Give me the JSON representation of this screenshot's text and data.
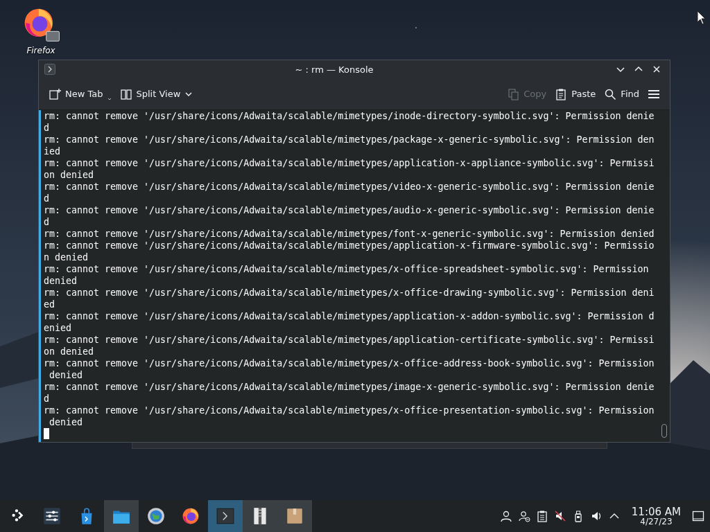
{
  "desktop": {
    "icons": [
      {
        "label": "Firefox"
      }
    ]
  },
  "window": {
    "title": "~ : rm — Konsole",
    "toolbar": [
      {
        "kind": "newtab",
        "label": "New Tab",
        "disabled": false
      },
      {
        "kind": "split",
        "label": "Split View",
        "disabled": false
      },
      {
        "kind": "copy",
        "label": "Copy",
        "disabled": true
      },
      {
        "kind": "paste",
        "label": "Paste",
        "disabled": false
      },
      {
        "kind": "find",
        "label": "Find",
        "disabled": false
      },
      {
        "kind": "menu",
        "disabled": false
      }
    ],
    "terminal": {
      "lines": [
        "rm: cannot remove '/usr/share/icons/Adwaita/scalable/mimetypes/inode-directory-symbolic.svg': Permission denied",
        "rm: cannot remove '/usr/share/icons/Adwaita/scalable/mimetypes/package-x-generic-symbolic.svg': Permission denied",
        "rm: cannot remove '/usr/share/icons/Adwaita/scalable/mimetypes/application-x-appliance-symbolic.svg': Permission denied",
        "rm: cannot remove '/usr/share/icons/Adwaita/scalable/mimetypes/video-x-generic-symbolic.svg': Permission denied",
        "rm: cannot remove '/usr/share/icons/Adwaita/scalable/mimetypes/audio-x-generic-symbolic.svg': Permission denied",
        "rm: cannot remove '/usr/share/icons/Adwaita/scalable/mimetypes/font-x-generic-symbolic.svg': Permission denied",
        "rm: cannot remove '/usr/share/icons/Adwaita/scalable/mimetypes/application-x-firmware-symbolic.svg': Permission denied",
        "rm: cannot remove '/usr/share/icons/Adwaita/scalable/mimetypes/x-office-spreadsheet-symbolic.svg': Permission denied",
        "rm: cannot remove '/usr/share/icons/Adwaita/scalable/mimetypes/x-office-drawing-symbolic.svg': Permission denied",
        "rm: cannot remove '/usr/share/icons/Adwaita/scalable/mimetypes/application-x-addon-symbolic.svg': Permission denied",
        "rm: cannot remove '/usr/share/icons/Adwaita/scalable/mimetypes/application-certificate-symbolic.svg': Permission denied",
        "rm: cannot remove '/usr/share/icons/Adwaita/scalable/mimetypes/x-office-address-book-symbolic.svg': Permission denied",
        "rm: cannot remove '/usr/share/icons/Adwaita/scalable/mimetypes/image-x-generic-symbolic.svg': Permission denied",
        "rm: cannot remove '/usr/share/icons/Adwaita/scalable/mimetypes/x-office-presentation-symbolic.svg': Permission denied"
      ]
    }
  },
  "taskbar": {
    "tasks": [
      {
        "kind": "launcher",
        "open": false,
        "selected": false
      },
      {
        "kind": "settings-panel",
        "open": false,
        "selected": false
      },
      {
        "kind": "store",
        "open": false,
        "selected": false
      },
      {
        "kind": "files",
        "open": true,
        "selected": false
      },
      {
        "kind": "system-settings",
        "open": false,
        "selected": false
      },
      {
        "kind": "firefox",
        "open": false,
        "selected": false
      },
      {
        "kind": "terminal",
        "open": true,
        "selected": true
      },
      {
        "kind": "archive",
        "open": true,
        "selected": false
      },
      {
        "kind": "package",
        "open": true,
        "selected": false
      }
    ],
    "clock": {
      "time": "11:06 AM",
      "date": "4/27/23"
    }
  }
}
